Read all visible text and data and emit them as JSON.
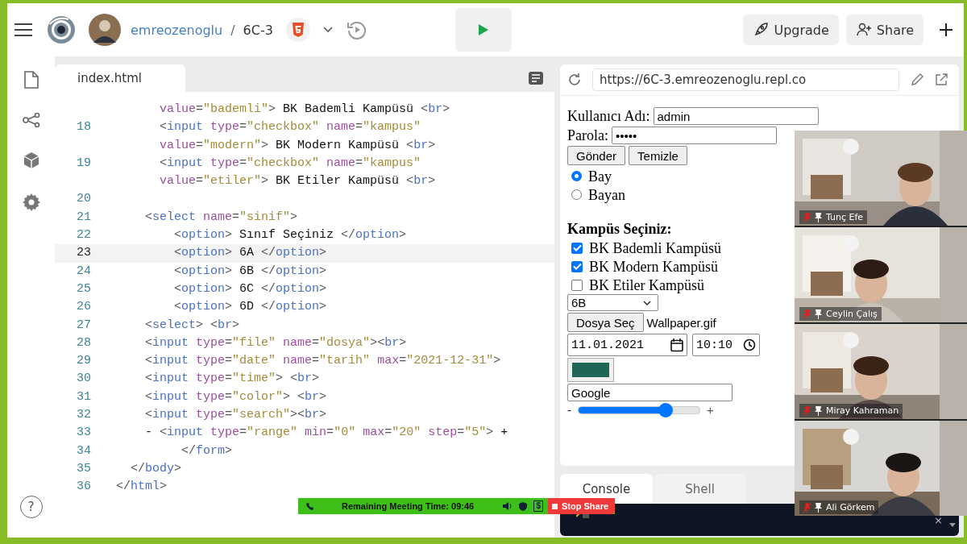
{
  "topbar": {
    "user": "emreozenoglu",
    "separator": "/",
    "repl": "6C-3",
    "buttons": [
      {
        "label": "Upgrade",
        "kind": "upgrade"
      },
      {
        "label": "Share",
        "kind": "share"
      }
    ]
  },
  "sidebar": {
    "help": "?"
  },
  "editor": {
    "tab": "index.html",
    "lines": [
      {
        "selected": false,
        "tokens": [
          {
            "kind": "attr",
            "text": "      value"
          },
          {
            "kind": "punct",
            "text": "="
          },
          {
            "kind": "string",
            "text": "\"bademli\""
          },
          {
            "kind": "punct",
            "text": ">"
          },
          {
            "kind": "text",
            "text": " BK Bademli Kampüsü "
          },
          {
            "kind": "punct",
            "text": "<"
          },
          {
            "kind": "tag",
            "text": "br"
          },
          {
            "kind": "punct",
            "text": ">"
          }
        ]
      },
      {
        "number": "18",
        "selected": false,
        "tokens": [
          {
            "kind": "punct",
            "text": "      <"
          },
          {
            "kind": "tag",
            "text": "input"
          },
          {
            "kind": "attr",
            "text": " type"
          },
          {
            "kind": "punct",
            "text": "="
          },
          {
            "kind": "string",
            "text": "\"checkbox\""
          },
          {
            "kind": "attr",
            "text": " name"
          },
          {
            "kind": "punct",
            "text": "="
          },
          {
            "kind": "string",
            "text": "\"kampus\""
          }
        ]
      },
      {
        "selected": false,
        "tokens": [
          {
            "kind": "attr",
            "text": "      value"
          },
          {
            "kind": "punct",
            "text": "="
          },
          {
            "kind": "string",
            "text": "\"modern\""
          },
          {
            "kind": "punct",
            "text": ">"
          },
          {
            "kind": "text",
            "text": " BK Modern Kampüsü "
          },
          {
            "kind": "punct",
            "text": "<"
          },
          {
            "kind": "tag",
            "text": "br"
          },
          {
            "kind": "punct",
            "text": ">"
          }
        ]
      },
      {
        "number": "19",
        "selected": false,
        "tokens": [
          {
            "kind": "punct",
            "text": "      <"
          },
          {
            "kind": "tag",
            "text": "input"
          },
          {
            "kind": "attr",
            "text": " type"
          },
          {
            "kind": "punct",
            "text": "="
          },
          {
            "kind": "string",
            "text": "\"checkbox\""
          },
          {
            "kind": "attr",
            "text": " name"
          },
          {
            "kind": "punct",
            "text": "="
          },
          {
            "kind": "string",
            "text": "\"kampus\""
          }
        ]
      },
      {
        "selected": false,
        "tokens": [
          {
            "kind": "attr",
            "text": "      value"
          },
          {
            "kind": "punct",
            "text": "="
          },
          {
            "kind": "string",
            "text": "\"etiler\""
          },
          {
            "kind": "punct",
            "text": ">"
          },
          {
            "kind": "text",
            "text": " BK Etiler Kampüsü "
          },
          {
            "kind": "punct",
            "text": "<"
          },
          {
            "kind": "tag",
            "text": "br"
          },
          {
            "kind": "punct",
            "text": ">"
          }
        ]
      },
      {
        "number": "20",
        "selected": false
      },
      {
        "number": "21",
        "selected": false,
        "tokens": [
          {
            "kind": "punct",
            "text": "    <"
          },
          {
            "kind": "tag",
            "text": "select"
          },
          {
            "kind": "attr",
            "text": " name"
          },
          {
            "kind": "punct",
            "text": "="
          },
          {
            "kind": "string",
            "text": "\"sinif\""
          },
          {
            "kind": "punct",
            "text": ">"
          }
        ]
      },
      {
        "number": "22",
        "selected": false,
        "tokens": [
          {
            "kind": "punct",
            "text": "        <"
          },
          {
            "kind": "tag",
            "text": "option"
          },
          {
            "kind": "punct",
            "text": ">"
          },
          {
            "kind": "text",
            "text": " Sınıf Seçiniz "
          },
          {
            "kind": "punct",
            "text": "</"
          },
          {
            "kind": "tag",
            "text": "option"
          },
          {
            "kind": "punct",
            "text": ">"
          }
        ]
      },
      {
        "number": "23",
        "selected": true,
        "tokens": [
          {
            "kind": "punct",
            "text": "        <"
          },
          {
            "kind": "tag",
            "text": "option"
          },
          {
            "kind": "punct",
            "text": ">"
          },
          {
            "kind": "text",
            "text": " 6A "
          },
          {
            "kind": "punct",
            "text": "</"
          },
          {
            "kind": "tag",
            "text": "option"
          },
          {
            "kind": "punct",
            "text": ">"
          }
        ]
      },
      {
        "number": "24",
        "selected": false,
        "tokens": [
          {
            "kind": "punct",
            "text": "        <"
          },
          {
            "kind": "tag",
            "text": "option"
          },
          {
            "kind": "punct",
            "text": ">"
          },
          {
            "kind": "text",
            "text": " 6B "
          },
          {
            "kind": "punct",
            "text": "</"
          },
          {
            "kind": "tag",
            "text": "option"
          },
          {
            "kind": "punct",
            "text": ">"
          }
        ]
      },
      {
        "number": "25",
        "selected": false,
        "tokens": [
          {
            "kind": "punct",
            "text": "        <"
          },
          {
            "kind": "tag",
            "text": "option"
          },
          {
            "kind": "punct",
            "text": ">"
          },
          {
            "kind": "text",
            "text": " 6C "
          },
          {
            "kind": "punct",
            "text": "</"
          },
          {
            "kind": "tag",
            "text": "option"
          },
          {
            "kind": "punct",
            "text": ">"
          }
        ]
      },
      {
        "number": "26",
        "selected": false,
        "tokens": [
          {
            "kind": "punct",
            "text": "        <"
          },
          {
            "kind": "tag",
            "text": "option"
          },
          {
            "kind": "punct",
            "text": ">"
          },
          {
            "kind": "text",
            "text": " 6D "
          },
          {
            "kind": "punct",
            "text": "</"
          },
          {
            "kind": "tag",
            "text": "option"
          },
          {
            "kind": "punct",
            "text": ">"
          }
        ]
      },
      {
        "number": "27",
        "selected": false,
        "tokens": [
          {
            "kind": "punct",
            "text": "    <"
          },
          {
            "kind": "tag",
            "text": "select"
          },
          {
            "kind": "punct",
            "text": "> <"
          },
          {
            "kind": "tag",
            "text": "br"
          },
          {
            "kind": "punct",
            "text": ">"
          }
        ]
      },
      {
        "number": "28",
        "selected": false,
        "tokens": [
          {
            "kind": "punct",
            "text": "    <"
          },
          {
            "kind": "tag",
            "text": "input"
          },
          {
            "kind": "attr",
            "text": " type"
          },
          {
            "kind": "punct",
            "text": "="
          },
          {
            "kind": "string",
            "text": "\"file\""
          },
          {
            "kind": "attr",
            "text": " name"
          },
          {
            "kind": "punct",
            "text": "="
          },
          {
            "kind": "string",
            "text": "\"dosya\""
          },
          {
            "kind": "punct",
            "text": "><"
          },
          {
            "kind": "tag",
            "text": "br"
          },
          {
            "kind": "punct",
            "text": ">"
          }
        ]
      },
      {
        "number": "29",
        "selected": false,
        "tokens": [
          {
            "kind": "punct",
            "text": "    <"
          },
          {
            "kind": "tag",
            "text": "input"
          },
          {
            "kind": "attr",
            "text": " type"
          },
          {
            "kind": "punct",
            "text": "="
          },
          {
            "kind": "string",
            "text": "\"date\""
          },
          {
            "kind": "attr",
            "text": " name"
          },
          {
            "kind": "punct",
            "text": "="
          },
          {
            "kind": "string",
            "text": "\"tarih\""
          },
          {
            "kind": "attr",
            "text": " max"
          },
          {
            "kind": "punct",
            "text": "="
          },
          {
            "kind": "string",
            "text": "\"2021-12-31\""
          },
          {
            "kind": "punct",
            "text": ">"
          }
        ]
      },
      {
        "number": "30",
        "selected": false,
        "tokens": [
          {
            "kind": "punct",
            "text": "    <"
          },
          {
            "kind": "tag",
            "text": "input"
          },
          {
            "kind": "attr",
            "text": " type"
          },
          {
            "kind": "punct",
            "text": "="
          },
          {
            "kind": "string",
            "text": "\"time\""
          },
          {
            "kind": "punct",
            "text": "> <"
          },
          {
            "kind": "tag",
            "text": "br"
          },
          {
            "kind": "punct",
            "text": ">"
          }
        ]
      },
      {
        "number": "31",
        "selected": false,
        "tokens": [
          {
            "kind": "punct",
            "text": "    <"
          },
          {
            "kind": "tag",
            "text": "input"
          },
          {
            "kind": "attr",
            "text": " type"
          },
          {
            "kind": "punct",
            "text": "="
          },
          {
            "kind": "string",
            "text": "\"color\""
          },
          {
            "kind": "punct",
            "text": "> <"
          },
          {
            "kind": "tag",
            "text": "br"
          },
          {
            "kind": "punct",
            "text": ">"
          }
        ]
      },
      {
        "number": "32",
        "selected": false,
        "tokens": [
          {
            "kind": "punct",
            "text": "    <"
          },
          {
            "kind": "tag",
            "text": "input"
          },
          {
            "kind": "attr",
            "text": " type"
          },
          {
            "kind": "punct",
            "text": "="
          },
          {
            "kind": "string",
            "text": "\"search\""
          },
          {
            "kind": "punct",
            "text": "><"
          },
          {
            "kind": "tag",
            "text": "br"
          },
          {
            "kind": "punct",
            "text": ">"
          }
        ]
      },
      {
        "number": "33",
        "selected": false,
        "tokens": [
          {
            "kind": "text",
            "text": "    - "
          },
          {
            "kind": "punct",
            "text": "<"
          },
          {
            "kind": "tag",
            "text": "input"
          },
          {
            "kind": "attr",
            "text": " type"
          },
          {
            "kind": "punct",
            "text": "="
          },
          {
            "kind": "string",
            "text": "\"range\""
          },
          {
            "kind": "attr",
            "text": " min"
          },
          {
            "kind": "punct",
            "text": "="
          },
          {
            "kind": "string",
            "text": "\"0\""
          },
          {
            "kind": "attr",
            "text": " max"
          },
          {
            "kind": "punct",
            "text": "="
          },
          {
            "kind": "string",
            "text": "\"20\""
          },
          {
            "kind": "attr",
            "text": " step"
          },
          {
            "kind": "punct",
            "text": "="
          },
          {
            "kind": "string",
            "text": "\"5\""
          },
          {
            "kind": "punct",
            "text": ">"
          },
          {
            "kind": "text",
            "text": " +"
          }
        ]
      },
      {
        "number": "34",
        "selected": false,
        "tokens": [
          {
            "kind": "punct",
            "text": "         </"
          },
          {
            "kind": "tag",
            "text": "form"
          },
          {
            "kind": "punct",
            "text": ">"
          }
        ]
      },
      {
        "number": "35",
        "selected": false,
        "tokens": [
          {
            "kind": "punct",
            "text": "  </"
          },
          {
            "kind": "tag",
            "text": "body"
          },
          {
            "kind": "punct",
            "text": ">"
          }
        ]
      },
      {
        "number": "36",
        "selected": false,
        "tokens": [
          {
            "kind": "punct",
            "text": "</"
          },
          {
            "kind": "tag",
            "text": "html"
          },
          {
            "kind": "punct",
            "text": ">"
          }
        ]
      }
    ]
  },
  "preview": {
    "url": "https://6C-3.emreozenoglu.repl.co",
    "form": {
      "username": {
        "label": "Kullanıcı Adı:",
        "value": "admin"
      },
      "password": {
        "label": "Parola:",
        "value": "•••••"
      },
      "buttons": [
        "Gönder",
        "Temizle"
      ],
      "radios": [
        {
          "label": "Bay",
          "selected": true
        },
        {
          "label": "Bayan",
          "selected": false
        }
      ],
      "campus_heading": "Kampüs Seçiniz:",
      "campuses": [
        {
          "label": "BK Bademli Kampüsü",
          "checked": true
        },
        {
          "label": "BK Modern Kampüsü",
          "checked": true
        },
        {
          "label": "BK Etiler Kampüsü",
          "checked": false
        }
      ],
      "class_select": {
        "value": "6B"
      },
      "file": {
        "button": "Dosya Seç",
        "value": "Wallpaper.gif"
      },
      "date": {
        "value": "11.01.2021"
      },
      "time": {
        "value": "10:10"
      },
      "color_input": {
        "color": "#1f6656"
      },
      "search": {
        "value": "Google"
      },
      "range": {
        "minus": "-",
        "plus": "+",
        "level": 0.72
      }
    }
  },
  "console": {
    "tabs": [
      {
        "label": "Console",
        "selected": true
      },
      {
        "label": "Shell",
        "selected": false
      }
    ],
    "close": "×"
  },
  "meeting": {
    "timer": "Remaining Meeting Time: 09:46",
    "fee": "$",
    "stop": "Stop Share",
    "participants": [
      {
        "name": "Tunç Efe",
        "muted": true
      },
      {
        "name": "Ceylin Çalış",
        "muted": true
      },
      {
        "name": "Miray Kahraman",
        "muted": true
      },
      {
        "name": "Ali Görkem",
        "muted": true
      }
    ]
  }
}
